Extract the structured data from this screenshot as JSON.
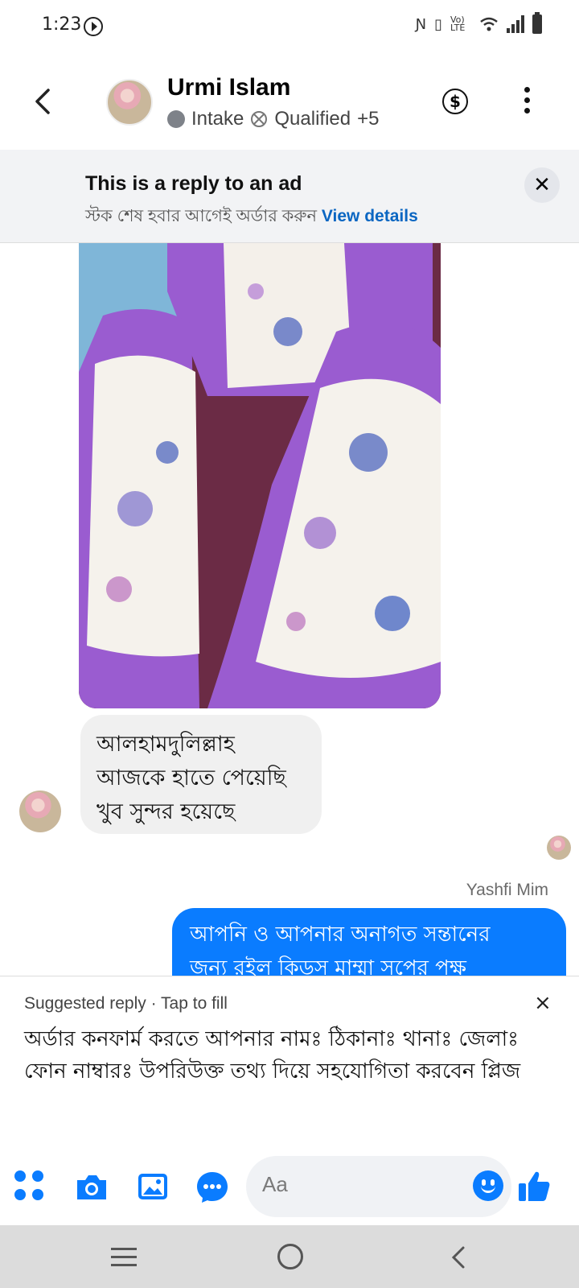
{
  "status_bar": {
    "time": "1:23",
    "network_text": "Vo) LTE"
  },
  "header": {
    "contact_name": "Urmi Islam",
    "labels": [
      "Intake",
      "Qualified",
      "+5"
    ],
    "dollar_symbol": "$"
  },
  "ad_banner": {
    "title": "This is a reply to an ad",
    "subtitle": "স্টক শেষ হবার আগেই অর্ডার করুন",
    "link": "View details",
    "close_symbol": "✕"
  },
  "messages": [
    {
      "direction": "incoming",
      "lines": [
        "আলহামদুলিল্লাহ",
        "আজকে হাতে পেয়েছি",
        "খুব সুন্দর হয়েছে"
      ]
    },
    {
      "direction": "outgoing",
      "sender": "Yashfi Mim",
      "lines": [
        "আপনি ও আপনার অনাগত সন্তানের",
        "জন্য রইল কিডস মাম্মা সপের পক্ষ"
      ]
    }
  ],
  "suggested_reply": {
    "heading": "Suggested reply · Tap to fill",
    "close_symbol": "×",
    "text": "অর্ডার কনফার্ম করতে আপনার নামঃ ঠিকানাঃ থানাঃ জেলাঃ ফোন নাম্বারঃ উপরিউক্ত তথ্য দিয়ে সহযোগিতা করবেন প্লিজ"
  },
  "composer": {
    "placeholder": "Aa",
    "icons": [
      "apps-icon",
      "camera-icon",
      "gallery-icon",
      "messenger-icon",
      "emoji-icon",
      "thumbs-up-icon"
    ]
  },
  "colors": {
    "accent": "#0a7cff",
    "link": "#0a66c2",
    "incoming_bubble": "#f0f0f0"
  }
}
